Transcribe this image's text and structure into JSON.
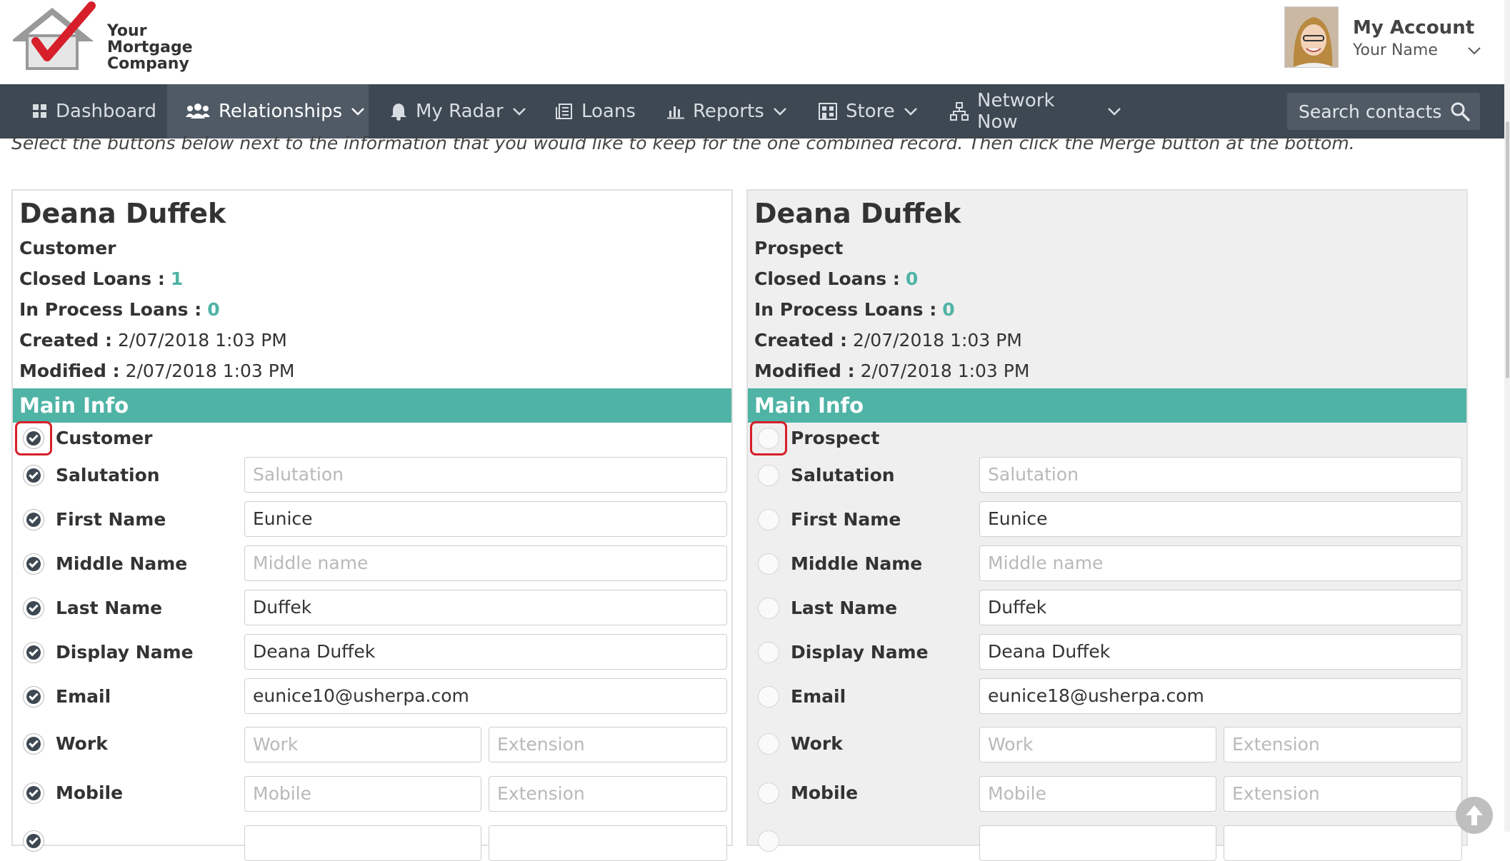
{
  "header": {
    "logo_lines": [
      "Your",
      "Mortgage",
      "Company"
    ],
    "account_title": "My Account",
    "account_name": "Your Name"
  },
  "nav": {
    "items": [
      {
        "label": "Dashboard",
        "icon": "dashboard-icon"
      },
      {
        "label": "Relationships",
        "icon": "people-icon"
      },
      {
        "label": "My Radar",
        "icon": "bell-icon"
      },
      {
        "label": "Loans",
        "icon": "loans-icon"
      },
      {
        "label": "Reports",
        "icon": "chart-icon"
      },
      {
        "label": "Store",
        "icon": "store-icon"
      },
      {
        "label": "Network Now",
        "icon": "network-icon"
      }
    ],
    "search_placeholder": "Search contacts"
  },
  "instructions": "Select the buttons below next to the information that you would like to keep for the one combined record. Then click the Merge button at the bottom.",
  "left": {
    "name": "Deana Duffek",
    "type": "Customer",
    "closed_loans_label": "Closed Loans :",
    "closed_loans": "1",
    "in_process_label": "In Process Loans :",
    "in_process": "0",
    "created_label": "Created :",
    "created": "2/07/2018 1:03 PM",
    "modified_label": "Modified :",
    "modified": "2/07/2018 1:03 PM",
    "section": "Main Info",
    "type_option": "Customer",
    "fields": {
      "salutation": {
        "label": "Salutation",
        "value": "",
        "placeholder": "Salutation"
      },
      "first_name": {
        "label": "First Name",
        "value": "Eunice",
        "placeholder": ""
      },
      "middle_name": {
        "label": "Middle Name",
        "value": "",
        "placeholder": "Middle name"
      },
      "last_name": {
        "label": "Last Name",
        "value": "Duffek",
        "placeholder": ""
      },
      "display_name": {
        "label": "Display Name",
        "value": "Deana Duffek",
        "placeholder": ""
      },
      "email": {
        "label": "Email",
        "value": "eunice10@usherpa.com",
        "placeholder": ""
      },
      "work": {
        "label": "Work",
        "placeholder": "Work",
        "ext_placeholder": "Extension"
      },
      "mobile": {
        "label": "Mobile",
        "placeholder": "Mobile",
        "ext_placeholder": "Extension"
      }
    }
  },
  "right": {
    "name": "Deana Duffek",
    "type": "Prospect",
    "closed_loans_label": "Closed Loans :",
    "closed_loans": "0",
    "in_process_label": "In Process Loans :",
    "in_process": "0",
    "created_label": "Created :",
    "created": "2/07/2018 1:03 PM",
    "modified_label": "Modified :",
    "modified": "2/07/2018 1:03 PM",
    "section": "Main Info",
    "type_option": "Prospect",
    "fields": {
      "salutation": {
        "label": "Salutation",
        "value": "",
        "placeholder": "Salutation"
      },
      "first_name": {
        "label": "First Name",
        "value": "Eunice",
        "placeholder": ""
      },
      "middle_name": {
        "label": "Middle Name",
        "value": "",
        "placeholder": "Middle name"
      },
      "last_name": {
        "label": "Last Name",
        "value": "Duffek",
        "placeholder": ""
      },
      "display_name": {
        "label": "Display Name",
        "value": "Deana Duffek",
        "placeholder": ""
      },
      "email": {
        "label": "Email",
        "value": "eunice18@usherpa.com",
        "placeholder": ""
      },
      "work": {
        "label": "Work",
        "placeholder": "Work",
        "ext_placeholder": "Extension"
      },
      "mobile": {
        "label": "Mobile",
        "placeholder": "Mobile",
        "ext_placeholder": "Extension"
      }
    }
  },
  "colors": {
    "nav_bg": "#3d4852",
    "accent": "#4fb3a5",
    "highlight": "#d61f2a"
  }
}
